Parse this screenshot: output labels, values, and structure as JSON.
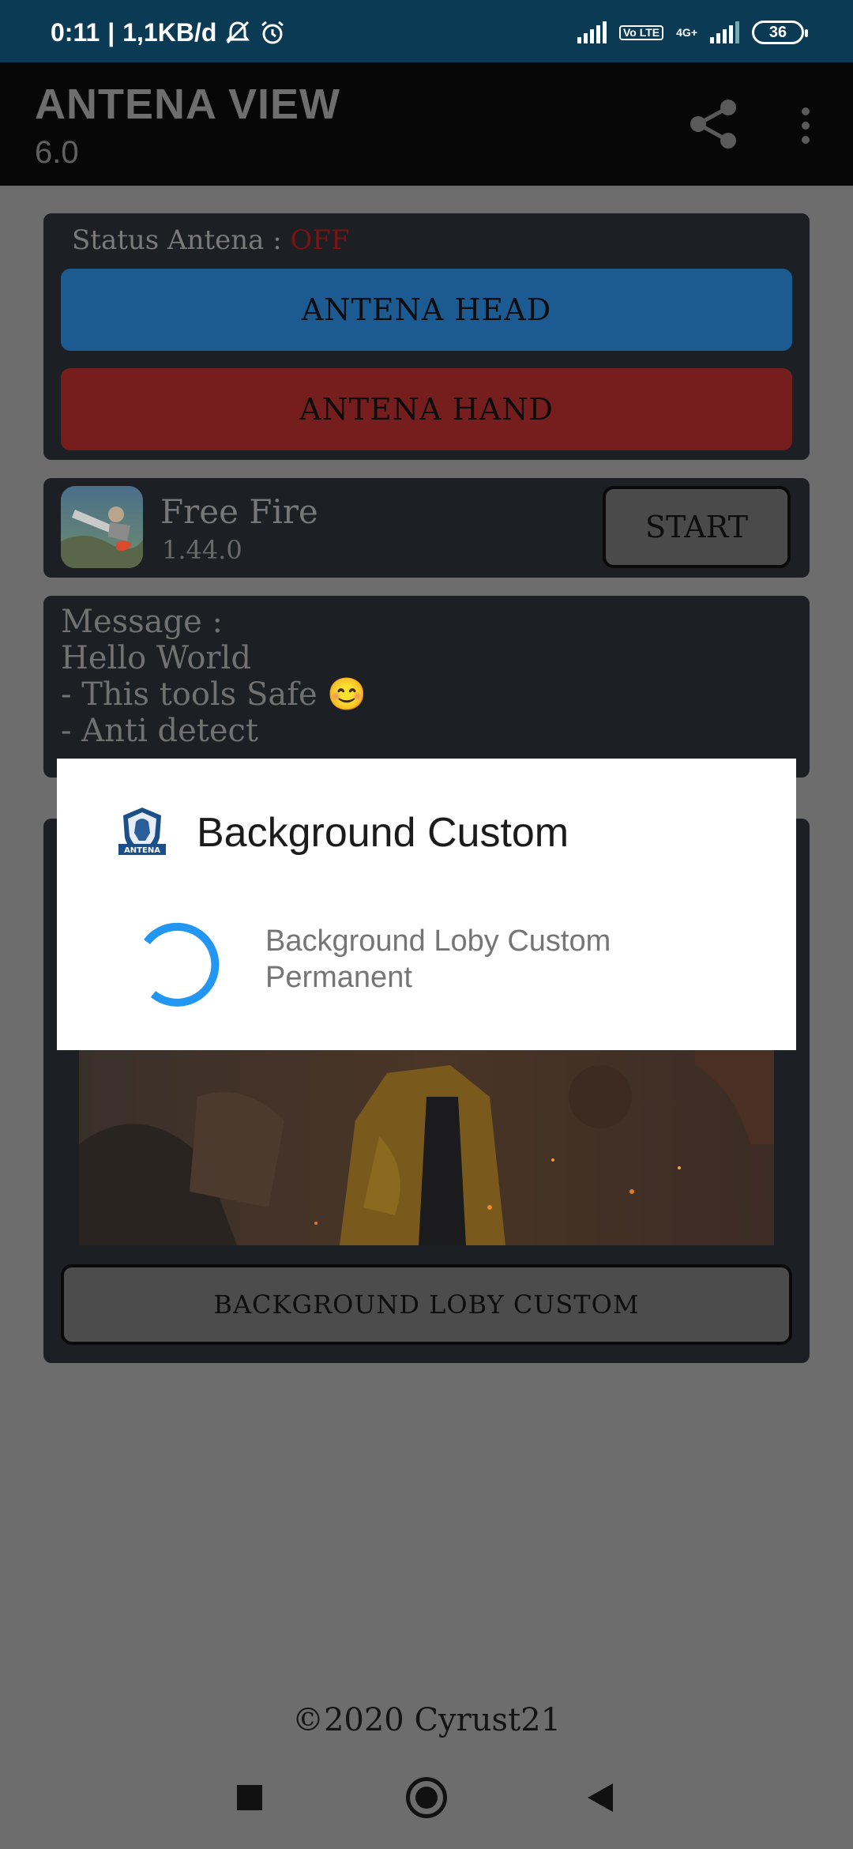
{
  "status_bar": {
    "time": "0:11",
    "separator": "|",
    "speed": "1,1KB/d",
    "volte_label": "Vo LTE",
    "network_type": "4G+",
    "battery": "36"
  },
  "app_bar": {
    "title": "ANTENA VIEW",
    "version": "6.0"
  },
  "status_card": {
    "label": "Status Antena : ",
    "value": "OFF",
    "head_button": "ANTENA HEAD",
    "hand_button": "ANTENA HAND"
  },
  "game_card": {
    "name": "Free Fire",
    "version": "1.44.0",
    "start_button": "START"
  },
  "message_card": {
    "lines": [
      "Message :",
      "Hello World",
      "- This tools Safe 😊",
      "- Anti detect"
    ]
  },
  "background_card": {
    "button": "BACKGROUND LOBY CUSTOM"
  },
  "footer": {
    "copyright": "©2020 Cyrust21"
  },
  "dialog": {
    "title": "Background Custom",
    "message": "Background Loby Custom Permanent",
    "logo_text": "ANTENA"
  },
  "colors": {
    "status_bar_bg": "#0b3a55",
    "scrim": "#6d6d6d",
    "head_button": "#1c5b92",
    "hand_button": "#761d1d",
    "spinner": "#2196f3"
  },
  "icons": [
    "alarm-off-icon",
    "alarm-icon",
    "signal-icon",
    "share-icon",
    "more-vert-icon",
    "free-fire-app-icon",
    "antena-logo-icon",
    "nav-recents-icon",
    "nav-home-icon",
    "nav-back-icon"
  ]
}
